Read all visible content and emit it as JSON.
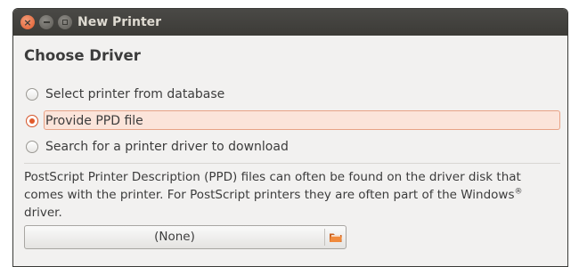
{
  "window": {
    "title": "New Printer"
  },
  "page": {
    "heading": "Choose Driver"
  },
  "options": [
    {
      "label": "Select printer from database",
      "selected": false
    },
    {
      "label": "Provide PPD file",
      "selected": true
    },
    {
      "label": "Search for a printer driver to download",
      "selected": false
    }
  ],
  "description": {
    "text_main": "PostScript Printer Description (PPD) files can often be found on the driver disk that comes with the printer. For PostScript printers they are often part of the Windows",
    "registered": "®",
    "text_end": "driver."
  },
  "file_chooser": {
    "value": "(None)",
    "icon": "folder-open-icon"
  },
  "colors": {
    "accent": "#e05a2b",
    "titlebar": "#3c3b37",
    "window_bg": "#f2f1f0",
    "focus_bg": "#fbe4da"
  }
}
